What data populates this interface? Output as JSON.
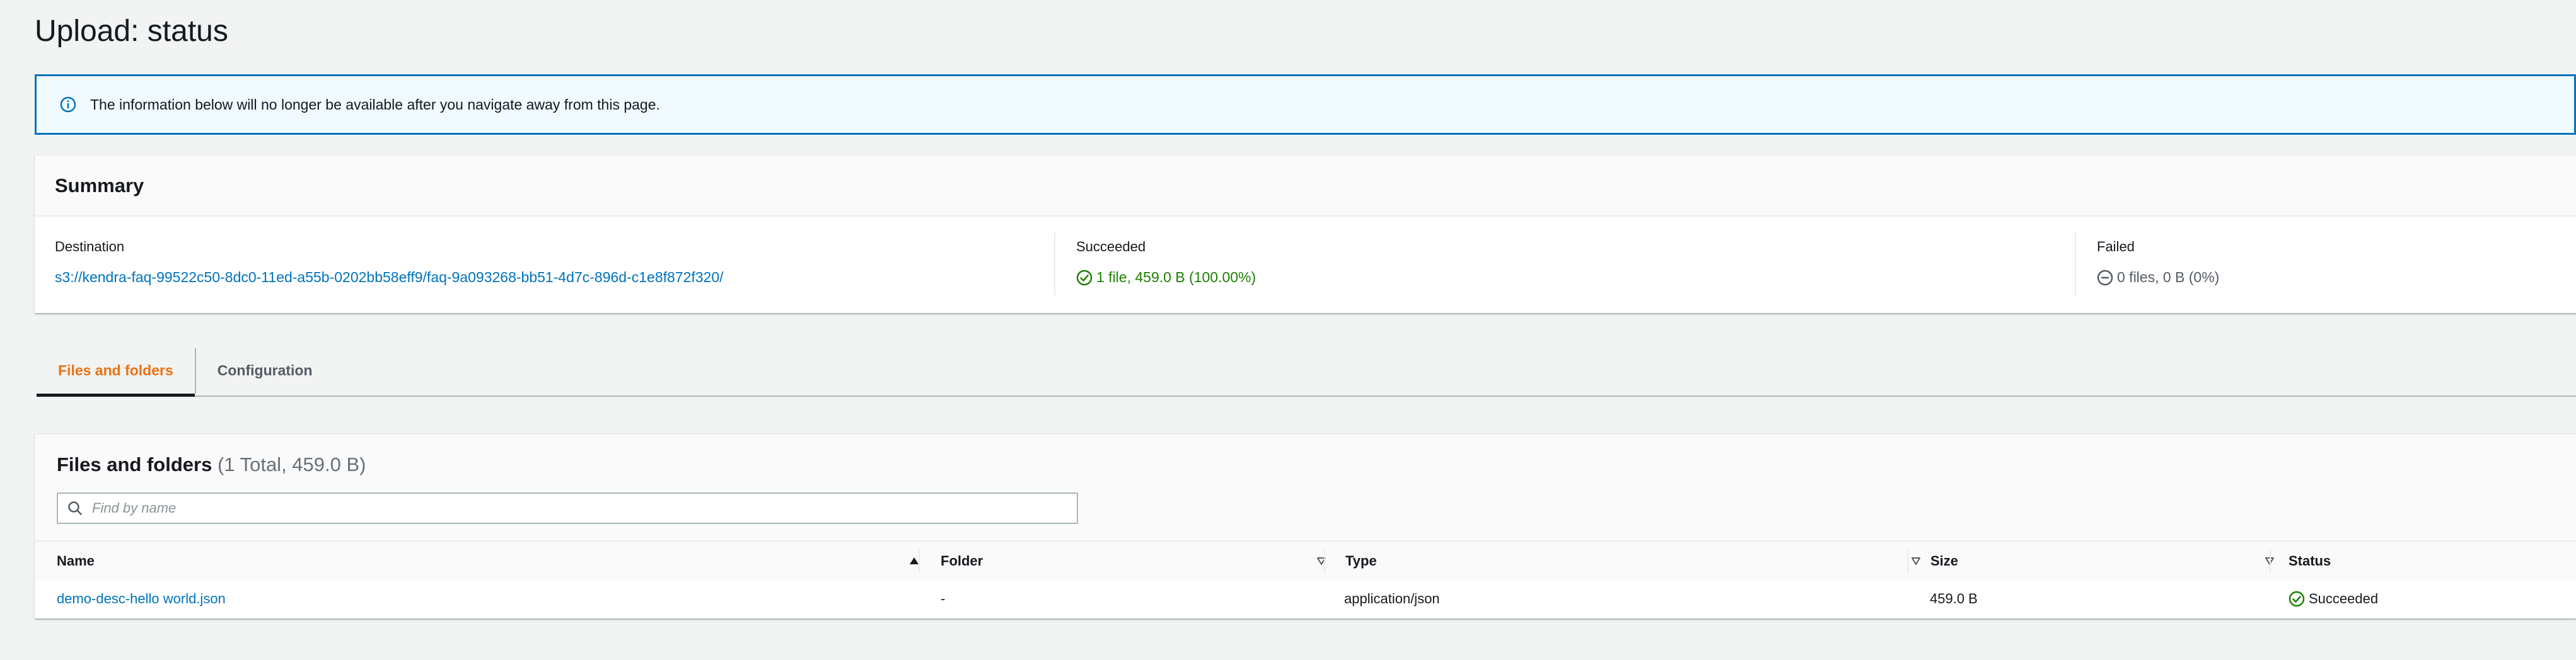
{
  "page": {
    "title": "Upload: status"
  },
  "alert": {
    "icon": "info-icon",
    "message": "The information below will no longer be available after you navigate away from this page."
  },
  "summary": {
    "title": "Summary",
    "destination": {
      "label": "Destination",
      "value": "s3://kendra-faq-99522c50-8dc0-11ed-a55b-0202bb58eff9/faq-9a093268-bb51-4d7c-896d-c1e8f872f320/"
    },
    "succeeded": {
      "label": "Succeeded",
      "icon": "check-circle-icon",
      "value": "1 file, 459.0 B (100.00%)"
    },
    "failed": {
      "label": "Failed",
      "icon": "minus-circle-icon",
      "value": "0 files, 0 B (0%)"
    }
  },
  "tabs": [
    {
      "label": "Files and folders",
      "active": true
    },
    {
      "label": "Configuration",
      "active": false
    }
  ],
  "files": {
    "title": "Files and folders",
    "count": "(1 Total, 459.0 B)",
    "search": {
      "placeholder": "Find by name",
      "value": ""
    },
    "columns": [
      {
        "label": "Name",
        "sort_icon": "sort-ascending-icon"
      },
      {
        "label": "Folder",
        "sort_icon": "sort-down-icon"
      },
      {
        "label": "Type",
        "sort_icon": "sort-down-icon"
      },
      {
        "label": "Size",
        "sort_icon": "sort-down-icon"
      },
      {
        "label": "Status"
      }
    ],
    "rows": [
      {
        "name": "demo-desc-hello world.json",
        "folder": "-",
        "type": "application/json",
        "size": "459.0 B",
        "status": "Succeeded",
        "status_icon": "check-circle-icon"
      }
    ]
  },
  "colors": {
    "link": "#0073bb",
    "success": "#1d8102",
    "active_tab": "#ec7211",
    "info_border": "#0073bb",
    "info_background": "#f1faff"
  }
}
